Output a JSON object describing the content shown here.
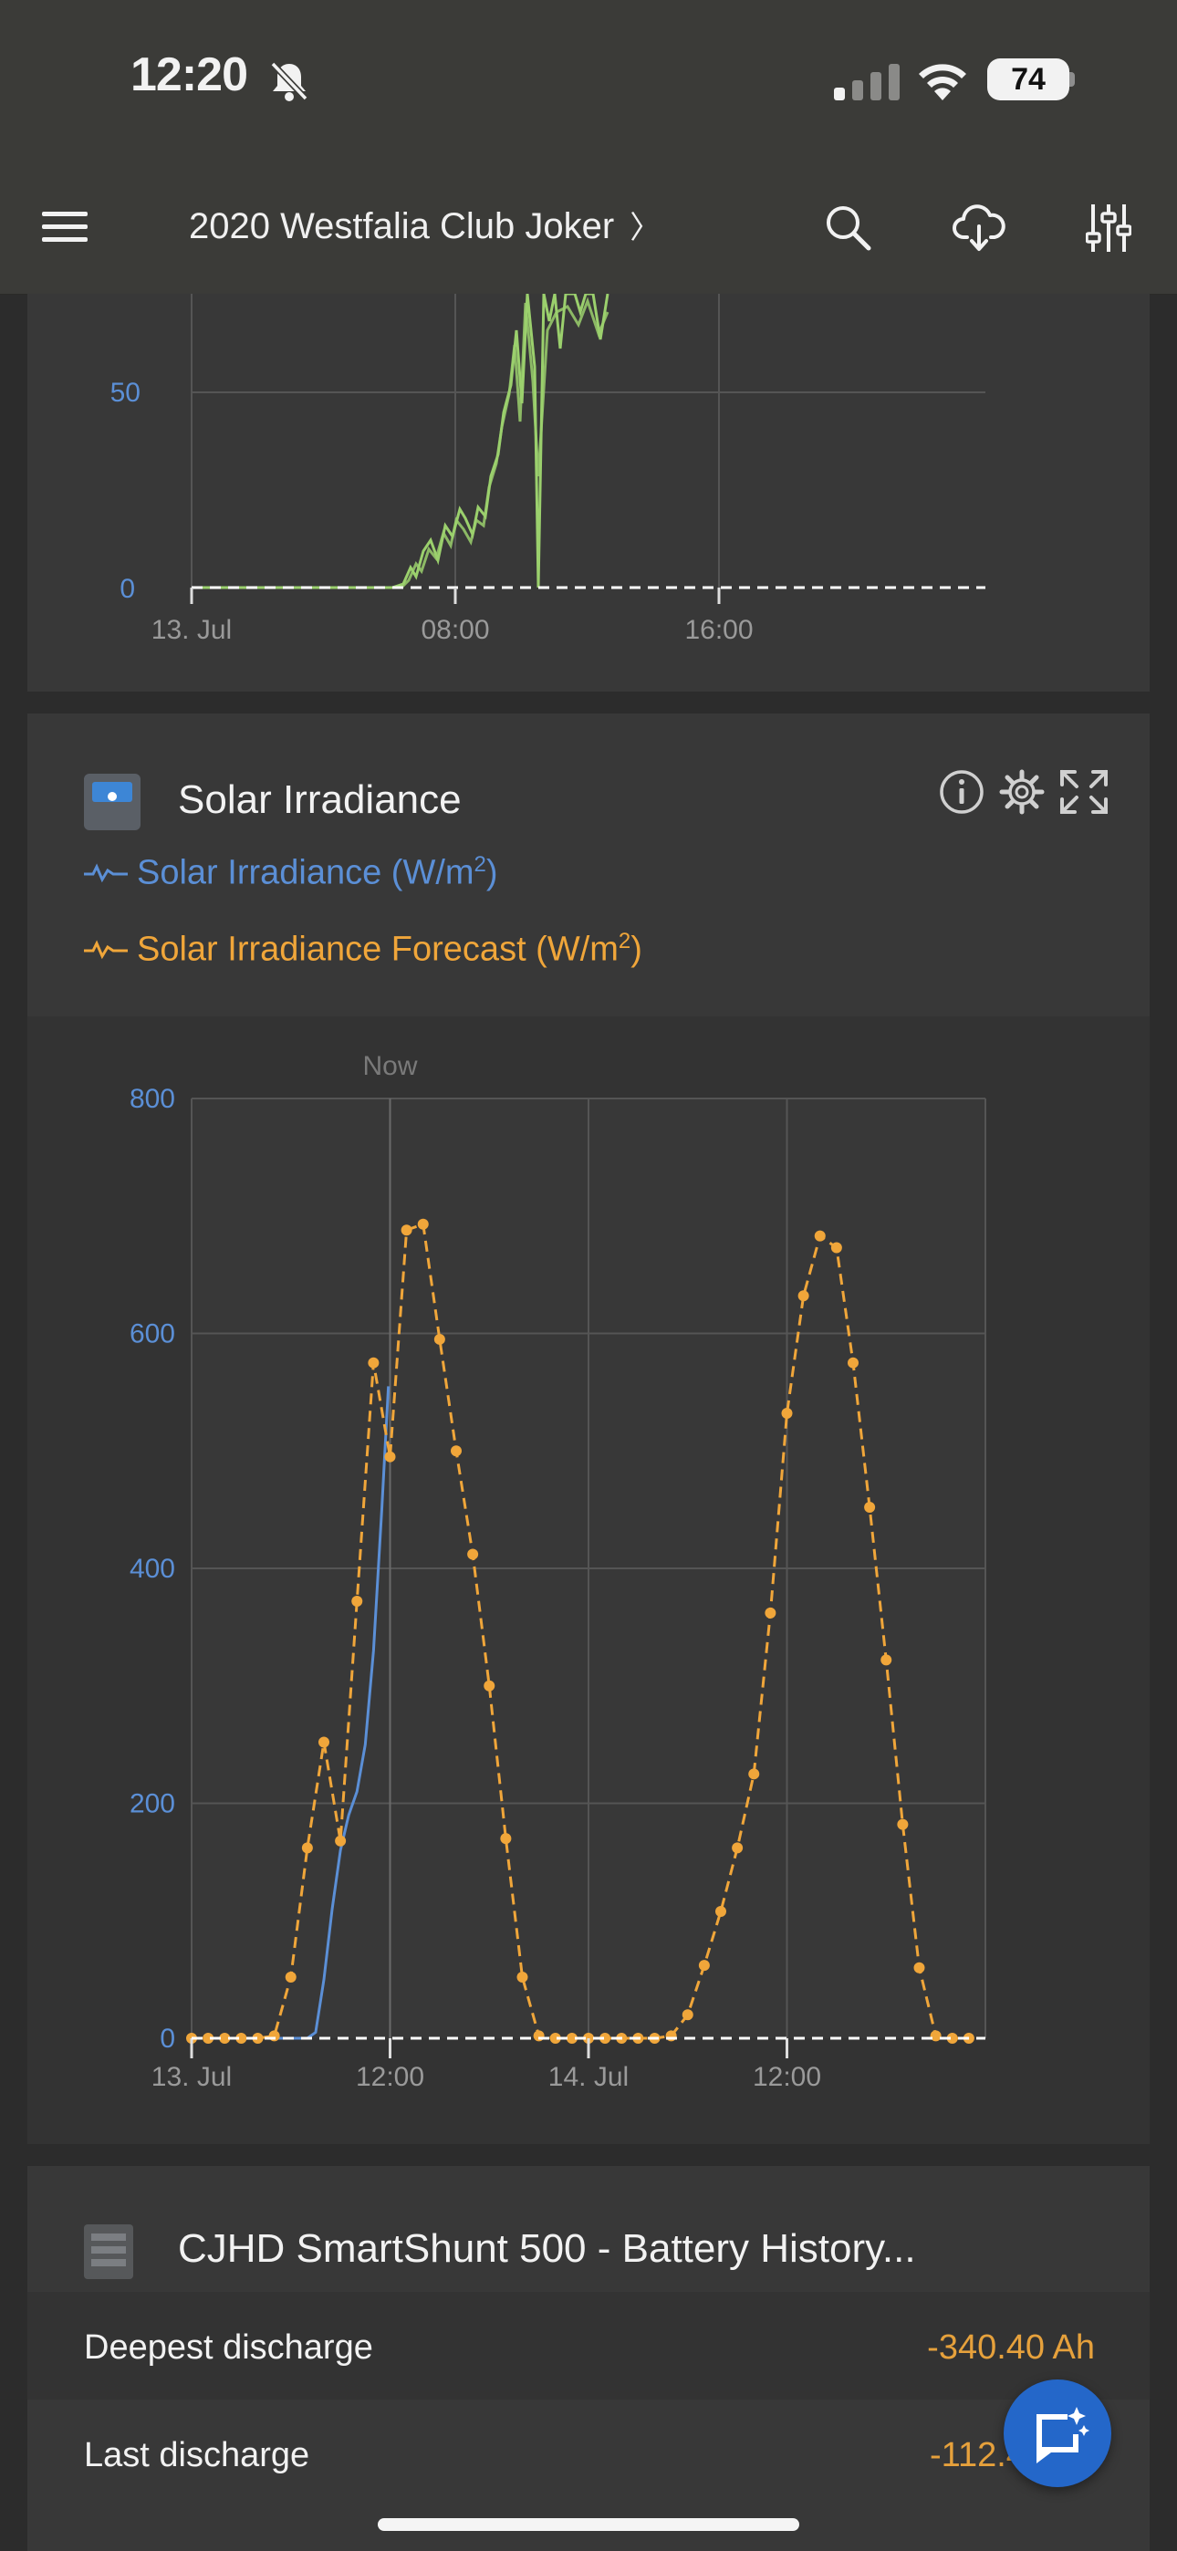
{
  "status_bar": {
    "time": "12:20",
    "battery_level": "74"
  },
  "nav": {
    "title": "2020 Westfalia Club Joker",
    "title_chevron": "〉"
  },
  "top_chart": {
    "y_ticks": [
      "50",
      "0"
    ],
    "x_ticks": [
      "13. Jul",
      "08:00",
      "16:00"
    ],
    "series_color": "#9bd06d"
  },
  "solar_card": {
    "title": "Solar Irradiance",
    "legend": [
      {
        "label": "Solar Irradiance (W/m",
        "sup": "2",
        "close": ")",
        "color": "#5b8fd6"
      },
      {
        "label": "Solar Irradiance Forecast (W/m",
        "sup": "2",
        "close": ")",
        "color": "#f0a63a"
      }
    ],
    "now_label": "Now"
  },
  "chart_data": {
    "type": "line",
    "title": "Solar Irradiance",
    "ylim": [
      0,
      800
    ],
    "y_ticks": [
      "800",
      "600",
      "400",
      "200",
      "0"
    ],
    "x_ticks": [
      "13. Jul",
      "12:00",
      "14. Jul",
      "12:00"
    ],
    "x_unit": "hours since 13. Jul 00:00",
    "now_x": 12,
    "series": [
      {
        "name": "Solar Irradiance (W/m²)",
        "color": "#5b8fd6",
        "x": [
          5,
          5.5,
          6,
          6.5,
          7,
          7.5,
          8,
          8.5,
          9,
          9.5,
          10,
          10.5,
          11,
          11.5,
          11.9
        ],
        "y": [
          0,
          0,
          0,
          0,
          0,
          5,
          50,
          110,
          160,
          190,
          210,
          250,
          330,
          450,
          555
        ]
      },
      {
        "name": "Solar Irradiance Forecast (W/m²)",
        "color": "#f0a63a",
        "x": [
          0,
          1,
          2,
          3,
          4,
          5,
          6,
          7,
          8,
          9,
          10,
          11,
          12,
          13,
          14,
          15,
          16,
          17,
          18,
          19,
          20,
          21,
          22,
          23,
          24,
          25,
          26,
          27,
          28,
          29,
          30,
          31,
          32,
          33,
          34,
          35,
          36,
          37,
          38,
          39,
          40,
          41,
          42,
          43,
          44,
          45,
          46,
          47
        ],
        "y": [
          0,
          0,
          0,
          0,
          0,
          2,
          52,
          162,
          252,
          168,
          372,
          575,
          495,
          688,
          693,
          595,
          500,
          412,
          300,
          170,
          52,
          2,
          0,
          0,
          0,
          0,
          0,
          0,
          0,
          2,
          20,
          62,
          108,
          162,
          225,
          362,
          532,
          632,
          683,
          673,
          575,
          452,
          322,
          182,
          60,
          2,
          0,
          0
        ]
      }
    ],
    "x_max": 48
  },
  "battery_card": {
    "title": "CJHD SmartShunt 500 - Battery History...",
    "rows": [
      {
        "label": "Deepest discharge",
        "value": "-340.40 Ah"
      },
      {
        "label": "Last discharge",
        "value": "-112.40 Ah"
      }
    ]
  }
}
